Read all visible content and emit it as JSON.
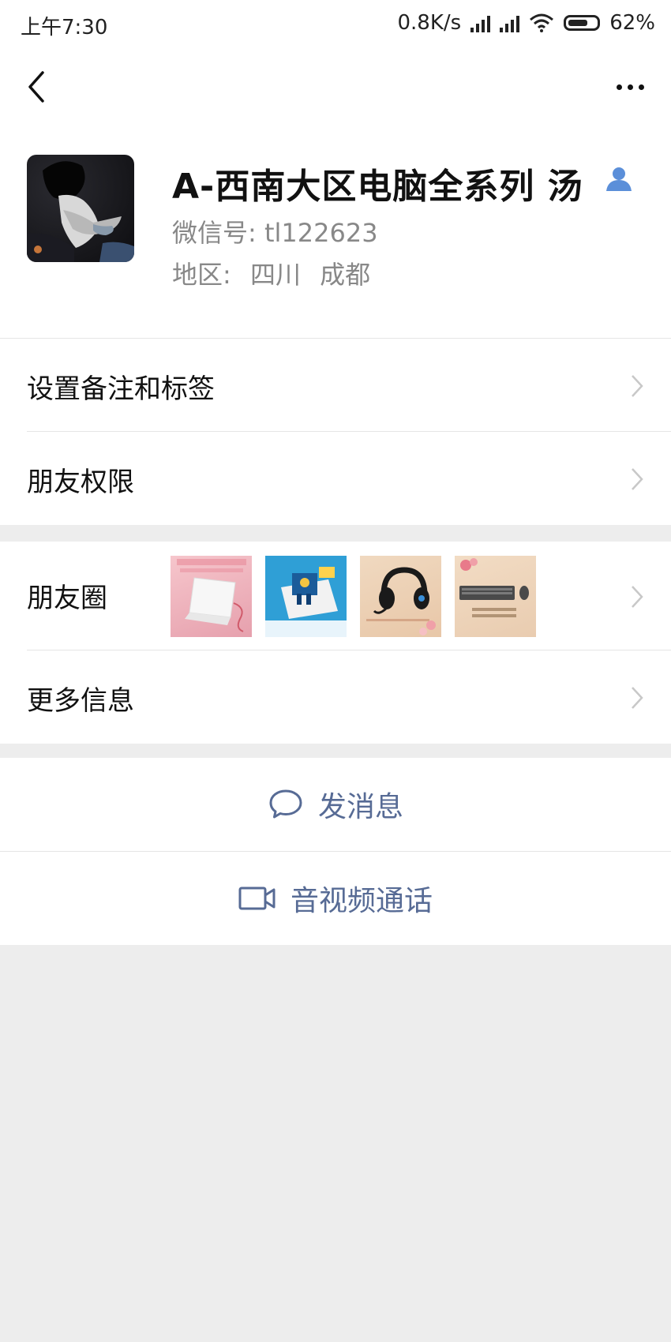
{
  "status_bar": {
    "time": "上午7:30",
    "speed": "0.8K/s",
    "battery": "62%"
  },
  "profile": {
    "name": "A-西南大区电脑全系列 汤",
    "wechat_id": "微信号: tl122623",
    "region_label": "地区:",
    "region_province": "四川",
    "region_city": "成都"
  },
  "menu": {
    "remark_tags": "设置备注和标签",
    "friend_permissions": "朋友权限",
    "moments": "朋友圈",
    "more_info": "更多信息"
  },
  "actions": {
    "send_message": "发消息",
    "video_call": "音视频通话"
  },
  "colors": {
    "link_blue": "#576b95",
    "verify_blue": "#5b8fd9",
    "page_bg": "#ededed"
  }
}
